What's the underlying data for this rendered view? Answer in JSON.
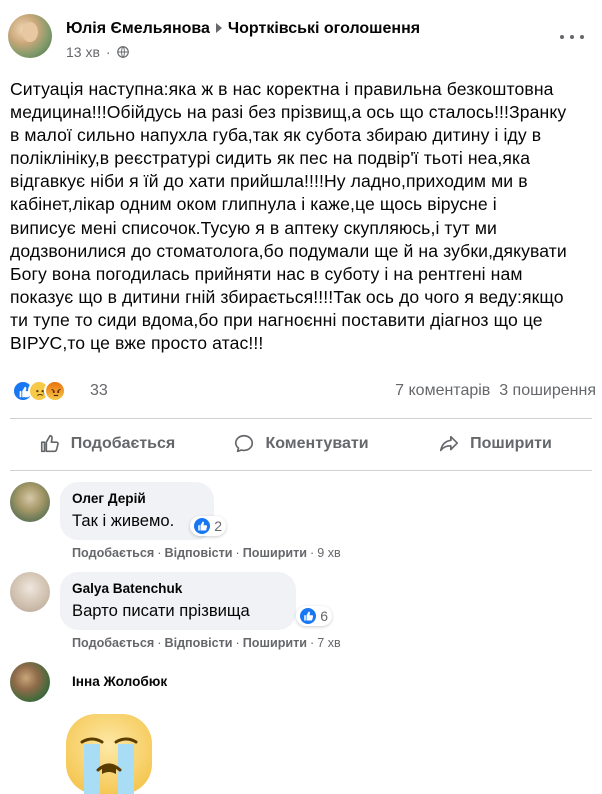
{
  "post": {
    "author": "Юлія Ємельянова",
    "group": "Чортківські оголошення",
    "time": "13 хв",
    "text": "Ситуація наступна:яка ж в нас коректна і правильна безкоштовна\nмедицина!!!Обійдусь на разі без прізвищ,а ось що сталось!!!Зранку\nв малої сильно напухла губа,так як субота збираю дитину і іду в\nполіклініку,в реєстратурі сидить як пес на подвір'ї тьоті неа,яка\nвідгавкує ніби я їй до хати прийшла!!!!Ну ладно,приходим ми в\nкабінет,лікар одним оком глипнула і каже,це щось вірусне і\nвиписує мені списочок.Тусую я в аптеку скупляюсь,і тут ми\nдодзвонилися до стоматолога,бо подумали ще й на зубки,дякувати\nБогу вона погодилась прийняти нас в суботу і на рентгені нам\nпоказує що в дитини гній збирається!!!!Так ось до чого я веду:якщо\nти тупе то сиди вдома,бо при нагноєнні поставити діагноз що це\nВІРУС,то це вже просто атас!!!",
    "reaction_count": "33",
    "comments_count": "7 коментарів",
    "shares_count": "3 поширення",
    "reactions": [
      "like-icon",
      "sad-icon",
      "angry-icon"
    ]
  },
  "actions": {
    "like": "Подобається",
    "comment": "Коментувати",
    "share": "Поширити"
  },
  "comments": [
    {
      "name": "Олег Дерій",
      "text": "Так і живемо.",
      "likes": "2",
      "like_label": "Подобається",
      "reply_label": "Відповісти",
      "share_label": "Поширити",
      "time": "9 хв"
    },
    {
      "name": "Galya Batenchuk",
      "text": "Варто писати прізвища",
      "likes": "6",
      "like_label": "Подобається",
      "reply_label": "Відповісти",
      "share_label": "Поширити",
      "time": "7 хв"
    },
    {
      "name": "Інна Жолобюк",
      "sticker": "crying-face-sticker"
    }
  ],
  "colors": {
    "accent": "#1877f2",
    "secondary_text": "#65676b",
    "bubble_bg": "#f0f2f5"
  }
}
